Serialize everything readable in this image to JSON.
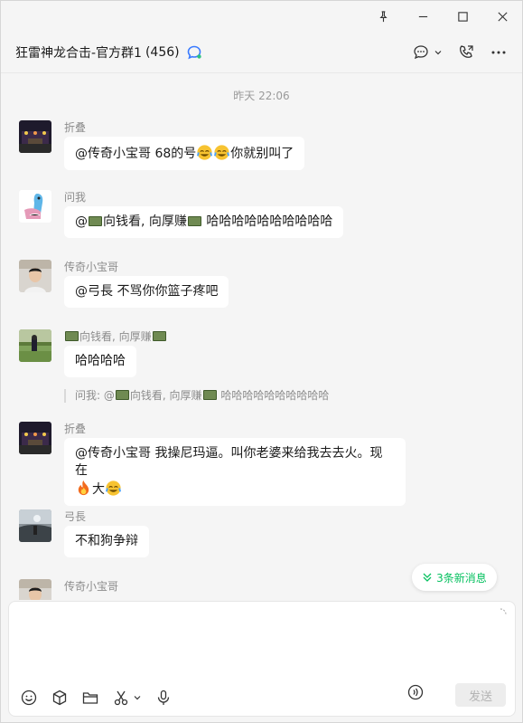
{
  "window": {
    "title": "狂雷神龙合击-官方群1",
    "member_count": "(456)"
  },
  "chat": {
    "time_separator": "昨天 22:06",
    "messages": [
      {
        "sender": "折叠",
        "text_parts": [
          "@传奇小宝哥 68的号",
          "emoji:laugh-cry",
          "emoji:laugh-cry",
          "你就别叫了"
        ]
      },
      {
        "sender": "问我",
        "text_parts": [
          "@",
          "money",
          "向钱看, 向厚赚",
          "money",
          " 哈哈哈哈哈哈哈哈哈哈"
        ]
      },
      {
        "sender": "传奇小宝哥",
        "text": "@弓長 不骂你你篮子疼吧"
      },
      {
        "sender_parts": [
          "money",
          "向钱看, 向厚赚",
          "money"
        ],
        "text": "哈哈哈哈"
      },
      {
        "quote_prefix": "问我: @",
        "quote_mid": "向钱看, 向厚赚",
        "quote_suffix": " 哈哈哈哈哈哈哈哈哈哈"
      },
      {
        "sender": "折叠",
        "text_line1": "@传奇小宝哥 我操尼玛逼。叫你老婆来给我去去火。现在",
        "text_line2": "大"
      },
      {
        "sender": "弓長",
        "text": "不和狗争辩"
      },
      {
        "sender": "传奇小宝哥"
      }
    ],
    "new_messages_label": "3条新消息"
  },
  "input": {
    "send_label": "发送"
  },
  "colors": {
    "accent": "#07c160",
    "background": "#f5f5f5",
    "bubble": "#ffffff"
  },
  "icons": [
    "pin-icon",
    "minimize-icon",
    "maximize-icon",
    "close-icon",
    "chat-bubble-icon",
    "call-icon",
    "more-icon",
    "emoji-icon",
    "box-icon",
    "folder-icon",
    "scissors-icon",
    "mic-icon",
    "voice-input-icon"
  ]
}
